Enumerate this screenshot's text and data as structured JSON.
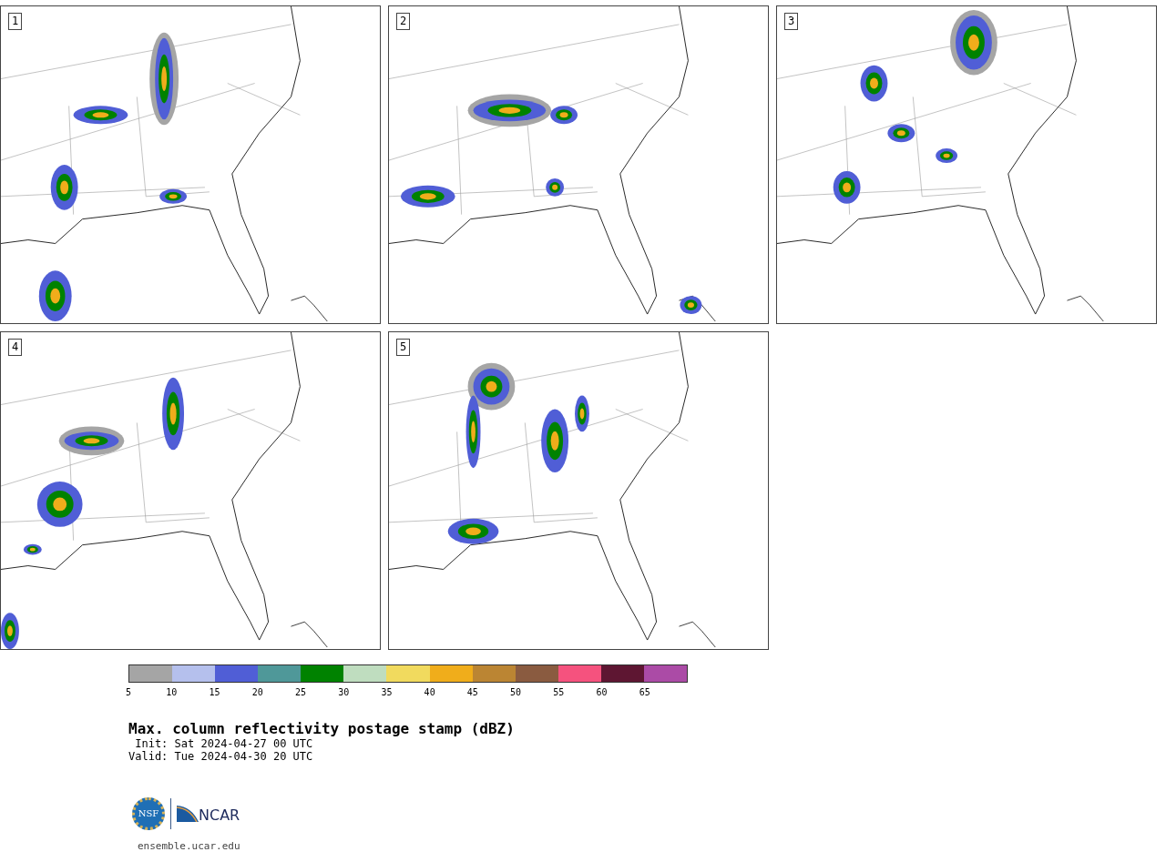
{
  "panels": [
    {
      "number": "1"
    },
    {
      "number": "2"
    },
    {
      "number": "3"
    },
    {
      "number": "4"
    },
    {
      "number": "5"
    }
  ],
  "colorbar": {
    "segments": [
      {
        "color": "#a5a5a5"
      },
      {
        "color": "#b5c0ed"
      },
      {
        "color": "#505ed6"
      },
      {
        "color": "#4f9899"
      },
      {
        "color": "#008200"
      },
      {
        "color": "#bfddbf"
      },
      {
        "color": "#f1da5e"
      },
      {
        "color": "#f0ad1b"
      },
      {
        "color": "#bb8533"
      },
      {
        "color": "#8a5b40"
      },
      {
        "color": "#f5527e"
      },
      {
        "color": "#5e1632"
      },
      {
        "color": "#ab4ba6"
      }
    ],
    "ticks": [
      "5",
      "10",
      "15",
      "20",
      "25",
      "30",
      "35",
      "40",
      "45",
      "50",
      "55",
      "60",
      "65"
    ]
  },
  "title": "Max. column reflectivity postage stamp (dBZ)",
  "init": " Init: Sat 2024-04-27 00 UTC",
  "valid": "Valid: Tue 2024-04-30 20 UTC",
  "logo": {
    "nsf": "NSF",
    "ncar": "NCAR"
  },
  "site": "ensemble.ucar.edu"
}
